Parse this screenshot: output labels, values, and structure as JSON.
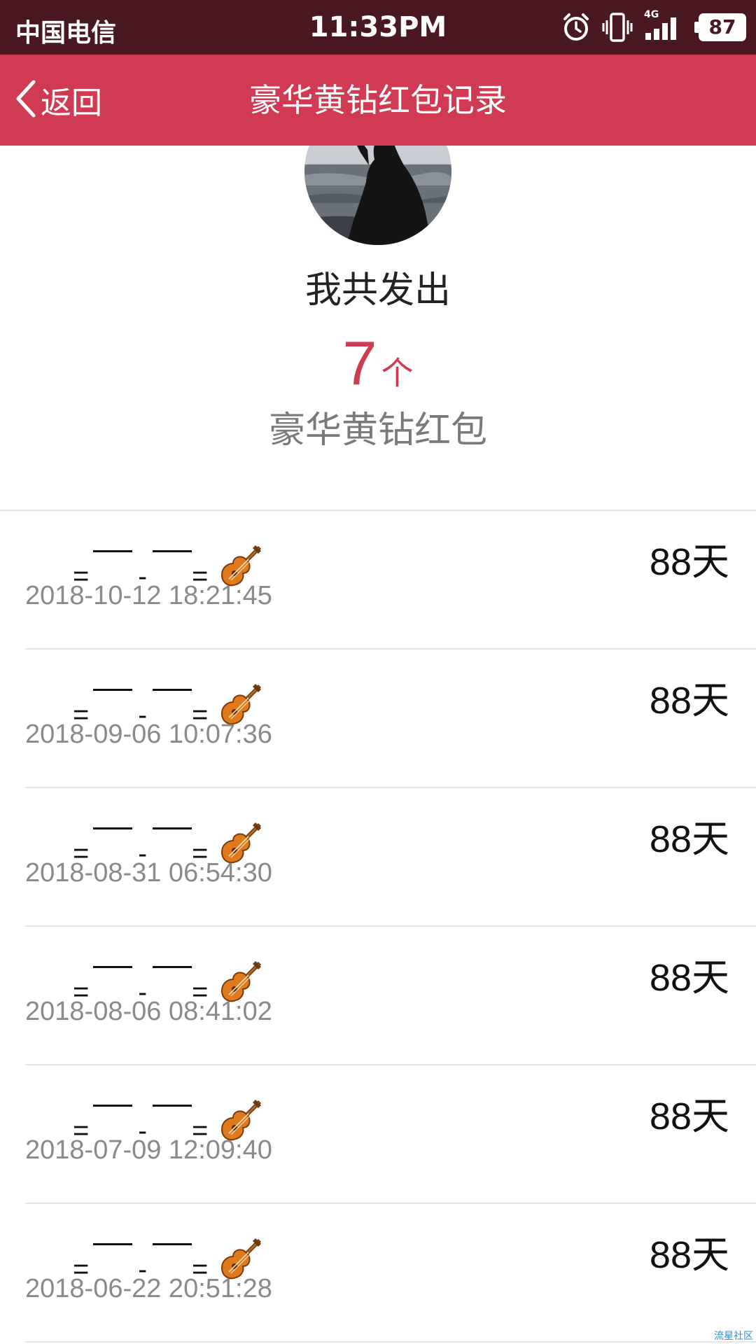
{
  "status_bar": {
    "carrier": "中国电信",
    "time": "11:33PM",
    "network": "4G",
    "battery": "87",
    "icons": [
      "alarm-icon",
      "vibrate-icon",
      "signal-icon",
      "battery-icon"
    ]
  },
  "nav": {
    "back_label": "返回",
    "title": "豪华黄钻红包记录"
  },
  "summary": {
    "label": "我共发出",
    "count": "7",
    "unit": "个",
    "type": "豪华黄钻红包"
  },
  "records": [
    {
      "name_parts": [
        "=",
        "-",
        "="
      ],
      "date": "2018-10-12 18:21:45",
      "days": "88天"
    },
    {
      "name_parts": [
        "=",
        "-",
        "="
      ],
      "date": "2018-09-06 10:07:36",
      "days": "88天"
    },
    {
      "name_parts": [
        "=",
        "-",
        "="
      ],
      "date": "2018-08-31 06:54:30",
      "days": "88天"
    },
    {
      "name_parts": [
        "=",
        "-",
        "="
      ],
      "date": "2018-08-06 08:41:02",
      "days": "88天"
    },
    {
      "name_parts": [
        "=",
        "-",
        "="
      ],
      "date": "2018-07-09 12:09:40",
      "days": "88天"
    },
    {
      "name_parts": [
        "=",
        "-",
        "="
      ],
      "date": "2018-06-22 20:51:28",
      "days": "88天"
    }
  ],
  "watermark": "流星社区",
  "colors": {
    "status_bar": "#4a1820",
    "nav_bar": "#d03a52",
    "accent": "#d03a52",
    "secondary_text": "#8a8a8a"
  }
}
